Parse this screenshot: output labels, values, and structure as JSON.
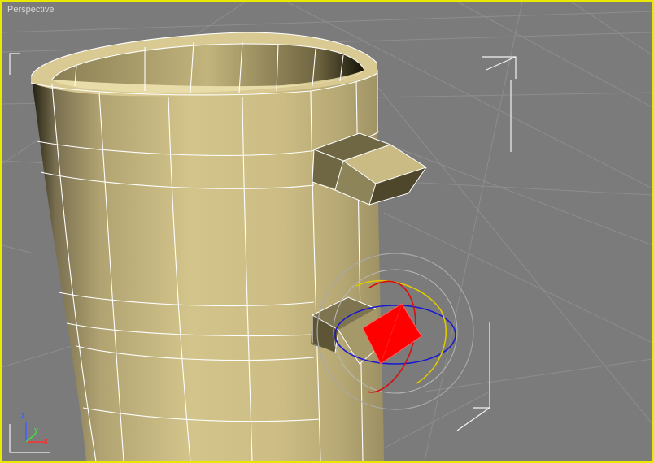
{
  "viewport": {
    "label": "Perspective",
    "border_color": "#e8e800",
    "background_color": "#7b7b7b"
  },
  "object": {
    "name": "mug",
    "color": "#c8b878",
    "edge_color": "#ffffff"
  },
  "selection": {
    "box_color": "#ff0000",
    "gizmo": "rotate-gizmo"
  },
  "axis_tripod": {
    "x_label": "x",
    "y_label": "y",
    "z_label": "z",
    "x_color": "#ff3030",
    "y_color": "#40e040",
    "z_color": "#4060ff"
  }
}
